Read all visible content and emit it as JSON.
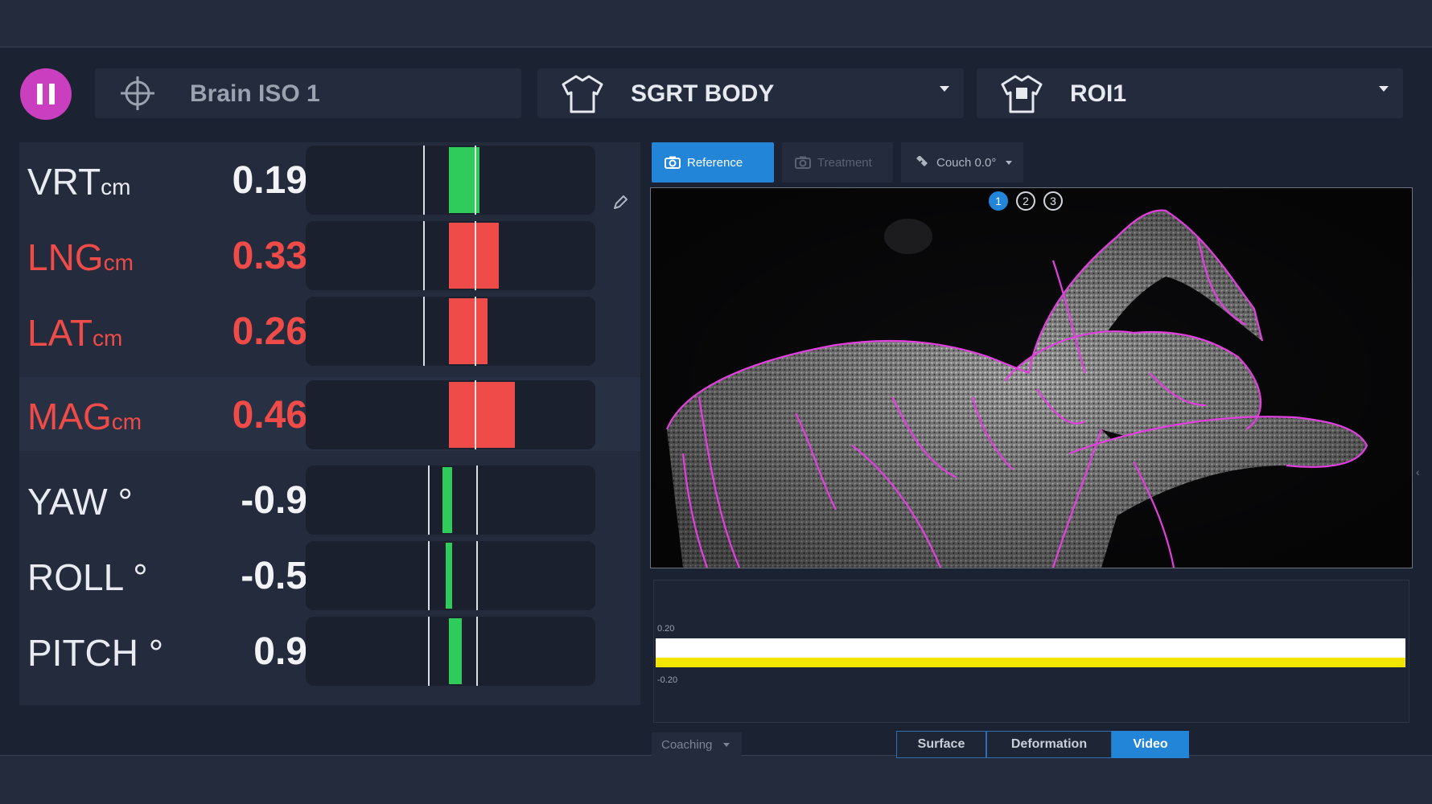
{
  "header": {
    "isocenter_label": "Brain ISO 1",
    "body_dropdown": "SGRT BODY",
    "roi_dropdown": "ROI1"
  },
  "metrics": [
    {
      "name": "VRT",
      "unit": "cm",
      "value": "0.19",
      "status": "ok",
      "bar_fill_color": "#2fcb5b"
    },
    {
      "name": "LNG",
      "unit": "cm",
      "value": "0.33",
      "status": "out",
      "bar_fill_color": "#ef4b48"
    },
    {
      "name": "LAT",
      "unit": "cm",
      "value": "0.26",
      "status": "out",
      "bar_fill_color": "#ef4b48"
    },
    {
      "name": "MAG",
      "unit": "cm",
      "value": "0.46",
      "status": "out",
      "bar_fill_color": "#ef4b48"
    },
    {
      "name": "YAW",
      "unit": "°",
      "value": "-0.9",
      "status": "ok",
      "bar_fill_color": "#2fcb5b"
    },
    {
      "name": "ROLL",
      "unit": "°",
      "value": "-0.5",
      "status": "ok",
      "bar_fill_color": "#2fcb5b"
    },
    {
      "name": "PITCH",
      "unit": "°",
      "value": "0.9",
      "status": "ok",
      "bar_fill_color": "#2fcb5b"
    }
  ],
  "view_tabs": {
    "reference": "Reference",
    "treatment": "Treatment",
    "couch": "Couch 0.0°"
  },
  "view_pages": [
    "1",
    "2",
    "3"
  ],
  "graph": {
    "upper_label": "0.20",
    "lower_label": "-0.20"
  },
  "footer": {
    "coaching": "Coaching",
    "modes": [
      "Surface",
      "Deformation",
      "Video"
    ],
    "active_mode": "Video"
  },
  "colors": {
    "accent": "#2285d8",
    "alert": "#ef4b48",
    "ok": "#2fcb5b",
    "pause": "#c93fbf",
    "contour": "#e23ee0"
  },
  "icons": [
    "pause-icon",
    "crosshair-icon",
    "shirt-icon",
    "roi-shirt-icon",
    "pencil-icon",
    "camera-icon",
    "couch-icon"
  ]
}
